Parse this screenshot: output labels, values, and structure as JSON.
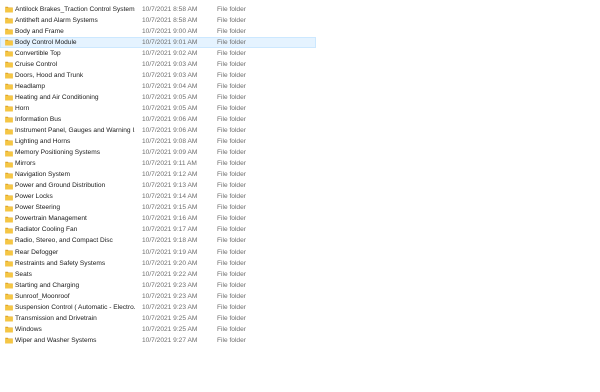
{
  "colors": {
    "folder": "#f5c644",
    "folder_dark": "#e0a82c",
    "selected_bg": "#e5f3ff",
    "secondary_text": "#6d6d6d"
  },
  "files": [
    {
      "name": "Antilock Brakes_Traction Control Systems",
      "date": "10/7/2021 8:58 AM",
      "type": "File folder"
    },
    {
      "name": "Antitheft and Alarm Systems",
      "date": "10/7/2021 8:58 AM",
      "type": "File folder"
    },
    {
      "name": "Body and Frame",
      "date": "10/7/2021 9:00 AM",
      "type": "File folder"
    },
    {
      "name": "Body Control Module",
      "date": "10/7/2021 9:01 AM",
      "type": "File folder",
      "selected": true
    },
    {
      "name": "Convertible Top",
      "date": "10/7/2021 9:02 AM",
      "type": "File folder"
    },
    {
      "name": "Cruise Control",
      "date": "10/7/2021 9:03 AM",
      "type": "File folder"
    },
    {
      "name": "Doors, Hood and Trunk",
      "date": "10/7/2021 9:03 AM",
      "type": "File folder"
    },
    {
      "name": "Headlamp",
      "date": "10/7/2021 9:04 AM",
      "type": "File folder"
    },
    {
      "name": "Heating and Air Conditioning",
      "date": "10/7/2021 9:05 AM",
      "type": "File folder"
    },
    {
      "name": "Horn",
      "date": "10/7/2021 9:05 AM",
      "type": "File folder"
    },
    {
      "name": "Information Bus",
      "date": "10/7/2021 9:06 AM",
      "type": "File folder"
    },
    {
      "name": "Instrument Panel, Gauges and Warning I...",
      "date": "10/7/2021 9:06 AM",
      "type": "File folder"
    },
    {
      "name": "Lighting and Horns",
      "date": "10/7/2021 9:08 AM",
      "type": "File folder"
    },
    {
      "name": "Memory Positioning Systems",
      "date": "10/7/2021 9:09 AM",
      "type": "File folder"
    },
    {
      "name": "Mirrors",
      "date": "10/7/2021 9:11 AM",
      "type": "File folder"
    },
    {
      "name": "Navigation System",
      "date": "10/7/2021 9:12 AM",
      "type": "File folder"
    },
    {
      "name": "Power and Ground Distribution",
      "date": "10/7/2021 9:13 AM",
      "type": "File folder"
    },
    {
      "name": "Power Locks",
      "date": "10/7/2021 9:14 AM",
      "type": "File folder"
    },
    {
      "name": "Power Steering",
      "date": "10/7/2021 9:15 AM",
      "type": "File folder"
    },
    {
      "name": "Powertrain Management",
      "date": "10/7/2021 9:16 AM",
      "type": "File folder"
    },
    {
      "name": "Radiator Cooling Fan",
      "date": "10/7/2021 9:17 AM",
      "type": "File folder"
    },
    {
      "name": "Radio, Stereo, and Compact Disc",
      "date": "10/7/2021 9:18 AM",
      "type": "File folder"
    },
    {
      "name": "Rear Defogger",
      "date": "10/7/2021 9:19 AM",
      "type": "File folder"
    },
    {
      "name": "Restraints and Safety Systems",
      "date": "10/7/2021 9:20 AM",
      "type": "File folder"
    },
    {
      "name": "Seats",
      "date": "10/7/2021 9:22 AM",
      "type": "File folder"
    },
    {
      "name": "Starting and Charging",
      "date": "10/7/2021 9:23 AM",
      "type": "File folder"
    },
    {
      "name": "Sunroof_Moonroof",
      "date": "10/7/2021 9:23 AM",
      "type": "File folder"
    },
    {
      "name": "Suspension Control ( Automatic - Electro...",
      "date": "10/7/2021 9:23 AM",
      "type": "File folder"
    },
    {
      "name": "Transmission and Drivetrain",
      "date": "10/7/2021 9:25 AM",
      "type": "File folder"
    },
    {
      "name": "Windows",
      "date": "10/7/2021 9:25 AM",
      "type": "File folder"
    },
    {
      "name": "Wiper and Washer Systems",
      "date": "10/7/2021 9:27 AM",
      "type": "File folder"
    }
  ]
}
